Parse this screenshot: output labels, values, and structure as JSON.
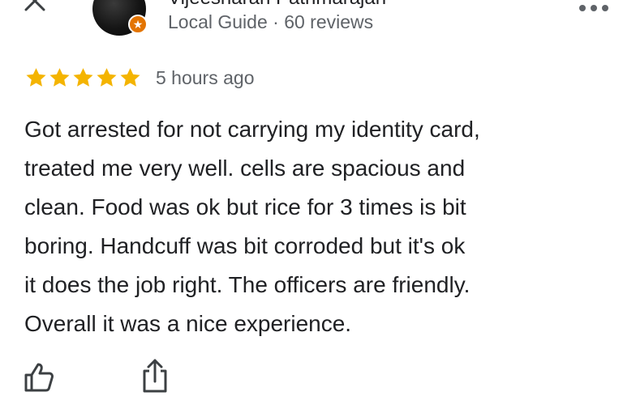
{
  "header": {
    "reviewer_name": "Vijeesharan Pathmarajah",
    "reviewer_meta": "Local Guide · 60 reviews",
    "close_icon": "close-icon",
    "more_icon": "more-options-icon",
    "badge_icon": "local-guide-star-icon"
  },
  "rating": {
    "stars": 5,
    "time_ago": "5 hours ago",
    "star_color": "#f4b400"
  },
  "review": {
    "lines": [
      "Got arrested for not carrying my identity card,",
      "treated me very well. cells are spacious and",
      "clean. Food was ok but rice for 3 times is bit",
      "boring. Handcuff was bit corroded but it's ok",
      "it does the job right. The officers are friendly.",
      "Overall it was a nice experience."
    ]
  },
  "actions": {
    "like_icon": "thumbs-up-icon",
    "share_icon": "share-icon"
  },
  "colors": {
    "text_primary": "#202124",
    "text_secondary": "#5f6368",
    "badge": "#e37400",
    "icon": "#3c4043"
  }
}
